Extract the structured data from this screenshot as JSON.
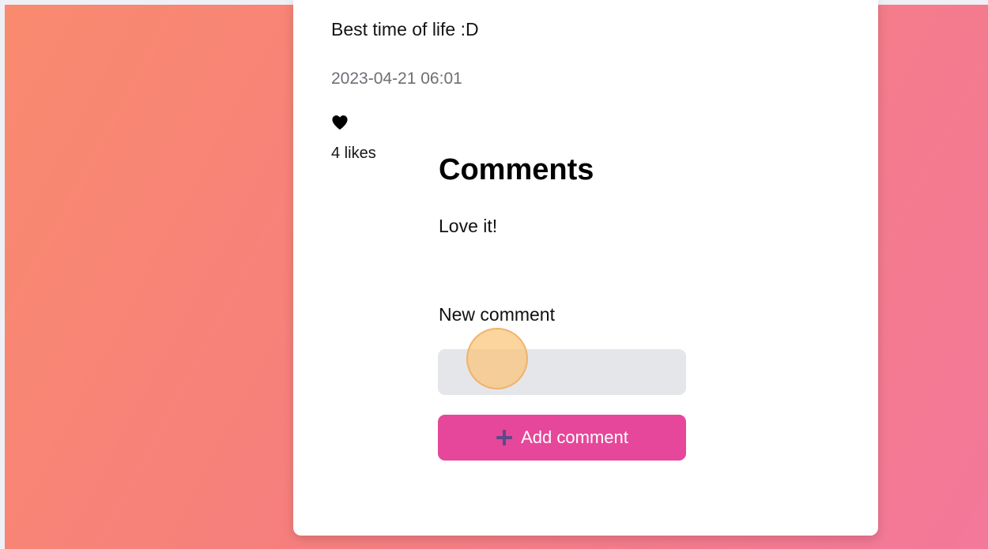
{
  "post": {
    "caption": "Best time of life :D",
    "timestamp": "2023-04-21 06:01",
    "likes_text": "4 likes",
    "like_icon": "heart-icon"
  },
  "comments": {
    "title": "Comments",
    "items": [
      "Love it!"
    ]
  },
  "new_comment": {
    "label": "New comment",
    "input_value": "",
    "button_label": "Add comment",
    "button_icon": "plus-icon"
  },
  "colors": {
    "button": "#e6479a",
    "input_bg": "#e4e6ea",
    "timestamp": "#6c6f75",
    "background_start": "#f98a6e",
    "background_end": "#f3789a"
  }
}
